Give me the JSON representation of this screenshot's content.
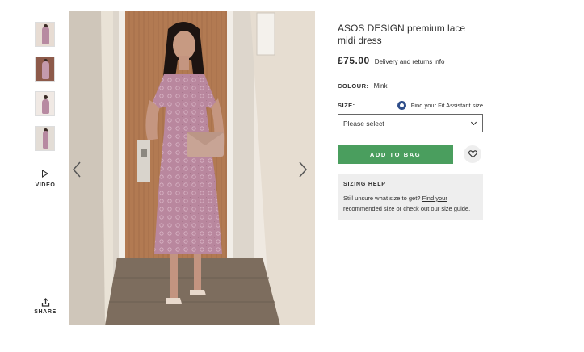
{
  "product": {
    "title_line1": "ASOS DESIGN premium lace",
    "title_line2": "midi dress",
    "price": "£75.00",
    "delivery_link": "Delivery and returns info",
    "colour_label": "COLOUR:",
    "colour_value": "Mink",
    "size_label": "SIZE:",
    "fit_assistant": "Find your Fit Assistant size",
    "size_select": "Please select",
    "add_to_bag": "ADD TO BAG"
  },
  "sizing_help": {
    "heading": "SIZING HELP",
    "text_a": "Still unsure what size to get? ",
    "link_a1": "Find your",
    "link_a2": "recommended size",
    "text_b": " or check out our ",
    "link_b": "size guide."
  },
  "gallery": {
    "video_label": "VIDEO",
    "share_label": "SHARE",
    "thumbnail_count": 4
  },
  "colors": {
    "add_to_bag": "#4a9e5e",
    "dress": "#b9879e",
    "door": "#b27a52"
  }
}
